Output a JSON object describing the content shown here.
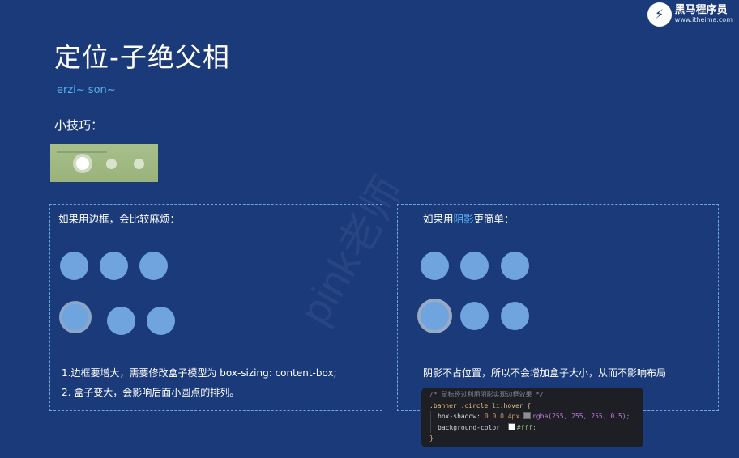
{
  "logo": {
    "mark": "⚡",
    "name": "黑马程序员",
    "url": "www.itheima.com"
  },
  "title": "定位-子绝父相",
  "subtitle": "erzi~ son~",
  "tip": "小技巧：",
  "watermark": "pink老师",
  "left_panel": {
    "heading": "如果用边框，会比较麻烦：",
    "notes": [
      "1.边框要增大，需要修改盒子模型为  box-sizing: content-box;",
      "2. 盒子变大，会影响后面小圆点的排列。"
    ]
  },
  "right_panel": {
    "heading_prefix": "如果用",
    "heading_highlight": "阴影",
    "heading_suffix": "更简单：",
    "note": "阴影不占位置，所以不会增加盒子大小，从而不影响布局"
  },
  "code": {
    "comment": "/* 鼠标经过利用阴影实现边框效果 */",
    "selector": ".banner .circle li:hover",
    "open_brace": "{",
    "prop1": "box-shadow:",
    "prop1_nums": "0 0 0 4px",
    "prop1_fn": "rgba(255, 255, 255, 0.5);",
    "prop2": "background-color:",
    "prop2_val": "#fff;",
    "close_brace": "}"
  },
  "colors": {
    "background": "#1b3a7a",
    "accent": "#5ab0f0",
    "circle": "#6fa4df",
    "code_bg": "#1d1f24"
  }
}
